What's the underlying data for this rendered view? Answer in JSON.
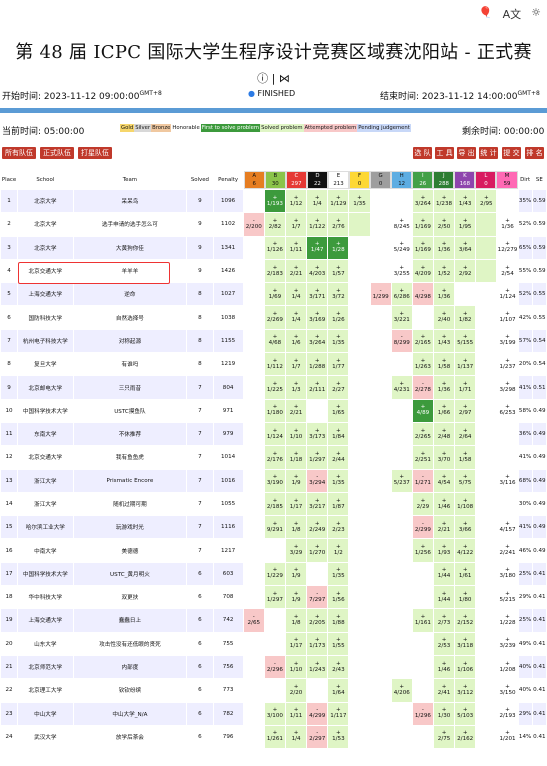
{
  "title": "第 48 届 ICPC 国际大学生程序设计竞赛区域赛沈阳站 - 正式赛",
  "top_icons": [
    "balloon-icon",
    "translate-icon",
    "settings-icon"
  ],
  "start_label": "开始时间: 2023-11-12 09:00:00",
  "start_tz": "GMT+8",
  "status": "FINISHED",
  "end_label": "结束时间: 2023-11-12 14:00:00",
  "end_tz": "GMT+8",
  "current_label": "当前时间: 05:00:00",
  "remaining_label": "剩余时间: 00:00:00",
  "legend": [
    "Gold",
    "Silver",
    "Bronze",
    "Honorable",
    "First to solve problem",
    "Solved problem",
    "Attempted problem",
    "Pending judgement"
  ],
  "buttons_left": [
    "所有队伍",
    "正式队伍",
    "打星队伍"
  ],
  "buttons_right": [
    "选 队",
    "工 具",
    "导 出",
    "统 计",
    "提 交",
    "排 名"
  ],
  "headers": {
    "place": "Place",
    "school": "School",
    "team": "Team",
    "solved": "Solved",
    "penalty": "Penalty",
    "dirt": "Dirt",
    "se": "SE"
  },
  "problems": [
    {
      "id": "A",
      "count": "6",
      "color": "#e67e22"
    },
    {
      "id": "B",
      "count": "30",
      "color": "#8bc34a"
    },
    {
      "id": "C",
      "count": "297",
      "color": "#e53935"
    },
    {
      "id": "D",
      "count": "22",
      "color": "#111111"
    },
    {
      "id": "E",
      "count": "213",
      "color": "#ffffff"
    },
    {
      "id": "F",
      "count": "0",
      "color": "#fdd835"
    },
    {
      "id": "G",
      "count": "0",
      "color": "#9e9e9e"
    },
    {
      "id": "H",
      "count": "12",
      "color": "#5dade2"
    },
    {
      "id": "I",
      "count": "26",
      "color": "#43a047"
    },
    {
      "id": "J",
      "count": "288",
      "color": "#2e7d32"
    },
    {
      "id": "K",
      "count": "168",
      "color": "#8e44ad"
    },
    {
      "id": "L",
      "count": "0",
      "color": "#d81b60"
    },
    {
      "id": "M",
      "count": "59",
      "color": "#ff69b4"
    }
  ],
  "rows": [
    {
      "place": "1",
      "school": "北京大学",
      "team": "呆呆鸟",
      "solved": "9",
      "penalty": "1096",
      "dirt": "35%",
      "se": "0.59",
      "cells": [
        "",
        "1/193",
        "1/12",
        "1/4",
        "1/129",
        "1/35",
        "",
        "",
        "3/264",
        "1/238",
        "1/43",
        "2/95",
        "",
        "4/135"
      ],
      "types": [
        "e",
        "f",
        "s",
        "s",
        "s",
        "s",
        "e",
        "e",
        "s",
        "s",
        "s",
        "s",
        "e",
        "s"
      ]
    },
    {
      "place": "2",
      "school": "北京大学",
      "team": "选手申请的选手怎么可",
      "solved": "9",
      "penalty": "1102",
      "dirt": "52%",
      "se": "0.59",
      "cells": [
        "2/200",
        "2/82",
        "1/7",
        "1/122",
        "2/76",
        "",
        "",
        "8/245",
        "1/169",
        "2/50",
        "1/95",
        "",
        "1/36"
      ],
      "types": [
        "a",
        "s",
        "s",
        "s",
        "s",
        "s",
        "e",
        "e",
        "s",
        "s",
        "s",
        "s",
        "e",
        "f"
      ]
    },
    {
      "place": "3",
      "school": "北京大学",
      "team": "大黄狗你佳",
      "solved": "9",
      "penalty": "1341",
      "dirt": "65%",
      "se": "0.59",
      "cells": [
        "",
        "1/126",
        "1/11",
        "1/47",
        "1/28",
        "",
        "",
        "5/249",
        "1/169",
        "1/36",
        "3/64",
        "",
        "12/279"
      ],
      "types": [
        "e",
        "s",
        "s",
        "f",
        "f",
        "e",
        "e",
        "e",
        "s",
        "s",
        "s",
        "s",
        "e",
        "s"
      ]
    },
    {
      "place": "4",
      "school": "北京交通大学",
      "team": "羊羊羊",
      "solved": "9",
      "penalty": "1426",
      "dirt": "55%",
      "se": "0.59",
      "cells": [
        "",
        "2/183",
        "2/21",
        "4/203",
        "1/57",
        "",
        "",
        "3/255",
        "4/209",
        "1/52",
        "2/92",
        "",
        "2/54"
      ],
      "types": [
        "e",
        "s",
        "s",
        "s",
        "s",
        "e",
        "e",
        "e",
        "s",
        "s",
        "s",
        "s",
        "e",
        "s"
      ]
    },
    {
      "place": "5",
      "school": "上海交通大学",
      "team": "逆命",
      "solved": "8",
      "penalty": "1027",
      "dirt": "52%",
      "se": "0.55",
      "cells": [
        "",
        "1/69",
        "1/4",
        "3/171",
        "3/72",
        "",
        "1/299",
        "6/286",
        "4/298",
        "1/36",
        "",
        "",
        "1/124"
      ],
      "types": [
        "e",
        "s",
        "s",
        "s",
        "s",
        "e",
        "a",
        "s",
        "a",
        "s",
        "e",
        "e",
        "e",
        "s"
      ]
    },
    {
      "place": "6",
      "school": "国防科技大学",
      "team": "自然选择号",
      "solved": "8",
      "penalty": "1038",
      "dirt": "42%",
      "se": "0.55",
      "cells": [
        "",
        "2/269",
        "1/4",
        "3/169",
        "1/26",
        "",
        "",
        "3/221",
        "",
        "2/40",
        "1/82",
        "",
        "1/107"
      ],
      "types": [
        "e",
        "s",
        "s",
        "s",
        "s",
        "e",
        "e",
        "s",
        "e",
        "s",
        "s",
        "e",
        "e",
        "s"
      ]
    },
    {
      "place": "7",
      "school": "杭州电子科技大学",
      "team": "对称起源",
      "solved": "8",
      "penalty": "1155",
      "dirt": "57%",
      "se": "0.54",
      "cells": [
        "",
        "4/68",
        "1/6",
        "3/264",
        "1/35",
        "",
        "",
        "8/299",
        "2/165",
        "1/43",
        "5/155",
        "",
        "3/199"
      ],
      "types": [
        "e",
        "s",
        "s",
        "s",
        "s",
        "e",
        "e",
        "a",
        "s",
        "s",
        "s",
        "e",
        "e",
        "s"
      ]
    },
    {
      "place": "8",
      "school": "复旦大学",
      "team": "有谁吗",
      "solved": "8",
      "penalty": "1219",
      "dirt": "20%",
      "se": "0.54",
      "cells": [
        "",
        "1/112",
        "1/7",
        "1/288",
        "1/77",
        "",
        "",
        "",
        "1/263",
        "1/58",
        "1/137",
        "",
        "1/237"
      ],
      "types": [
        "e",
        "s",
        "s",
        "s",
        "s",
        "e",
        "e",
        "e",
        "s",
        "s",
        "s",
        "e",
        "e",
        "s"
      ]
    },
    {
      "place": "9",
      "school": "北京邮电大学",
      "team": "三只雨昔",
      "solved": "7",
      "penalty": "804",
      "dirt": "41%",
      "se": "0.51",
      "cells": [
        "",
        "1/225",
        "1/3",
        "2/111",
        "2/27",
        "",
        "",
        "4/231",
        "2/278",
        "1/36",
        "1/71",
        "",
        "3/298"
      ],
      "types": [
        "e",
        "s",
        "s",
        "s",
        "s",
        "e",
        "e",
        "s",
        "a",
        "s",
        "s",
        "e",
        "e",
        "a"
      ]
    },
    {
      "place": "10",
      "school": "中国科学技术大学",
      "team": "USTC摸鱼队",
      "solved": "7",
      "penalty": "971",
      "dirt": "58%",
      "se": "0.49",
      "cells": [
        "",
        "1/180",
        "2/21",
        "",
        "1/65",
        "",
        "",
        "",
        "4/89",
        "1/66",
        "2/97",
        "",
        "6/253"
      ],
      "types": [
        "e",
        "s",
        "s",
        "e",
        "s",
        "e",
        "e",
        "e",
        "f",
        "s",
        "s",
        "e",
        "e",
        "s"
      ]
    },
    {
      "place": "11",
      "school": "东南大学",
      "team": "不休推荐",
      "solved": "7",
      "penalty": "979",
      "dirt": "36%",
      "se": "0.49",
      "cells": [
        "",
        "1/124",
        "1/10",
        "3/173",
        "1/84",
        "",
        "",
        "",
        "2/265",
        "2/48",
        "2/64",
        "",
        "",
        ""
      ],
      "types": [
        "e",
        "s",
        "s",
        "s",
        "s",
        "e",
        "e",
        "e",
        "s",
        "s",
        "s",
        "e",
        "e",
        "e"
      ]
    },
    {
      "place": "12",
      "school": "北京交通大学",
      "team": "我有鱼鱼虎",
      "solved": "7",
      "penalty": "1014",
      "dirt": "41%",
      "se": "0.49",
      "cells": [
        "",
        "2/176",
        "1/18",
        "1/297",
        "2/44",
        "",
        "",
        "",
        "2/251",
        "3/70",
        "1/58",
        "",
        "",
        ""
      ],
      "types": [
        "e",
        "s",
        "s",
        "s",
        "s",
        "e",
        "e",
        "e",
        "s",
        "s",
        "s",
        "e",
        "e",
        "e"
      ]
    },
    {
      "place": "13",
      "school": "浙江大学",
      "team": "Prismatic Encore",
      "solved": "7",
      "penalty": "1016",
      "dirt": "68%",
      "se": "0.49",
      "cells": [
        "",
        "3/190",
        "1/9",
        "3/294",
        "1/35",
        "",
        "",
        "5/237",
        "1/271",
        "4/54",
        "5/75",
        "",
        "3/116"
      ],
      "types": [
        "e",
        "s",
        "s",
        "a",
        "s",
        "e",
        "e",
        "s",
        "a",
        "s",
        "s",
        "e",
        "e",
        "s"
      ]
    },
    {
      "place": "14",
      "school": "浙江大学",
      "team": "随机过期可期",
      "solved": "7",
      "penalty": "1055",
      "dirt": "30%",
      "se": "0.49",
      "cells": [
        "",
        "2/185",
        "1/17",
        "3/217",
        "1/87",
        "",
        "",
        "",
        "2/29",
        "1/46",
        "1/108",
        "",
        "",
        ""
      ],
      "types": [
        "e",
        "s",
        "s",
        "s",
        "s",
        "e",
        "e",
        "e",
        "s",
        "s",
        "s",
        "e",
        "e",
        "e"
      ]
    },
    {
      "place": "15",
      "school": "哈尔滨工业大学",
      "team": "玩游戏时光",
      "solved": "7",
      "penalty": "1116",
      "dirt": "41%",
      "se": "0.49",
      "cells": [
        "",
        "9/291",
        "1/8",
        "2/249",
        "2/23",
        "",
        "",
        "",
        "2/299",
        "2/21",
        "3/66",
        "",
        "4/157"
      ],
      "types": [
        "e",
        "s",
        "s",
        "s",
        "s",
        "e",
        "e",
        "e",
        "a",
        "s",
        "s",
        "e",
        "e",
        "s"
      ]
    },
    {
      "place": "16",
      "school": "中南大学",
      "team": "美德德",
      "solved": "7",
      "penalty": "1217",
      "dirt": "46%",
      "se": "0.49",
      "cells": [
        "",
        "",
        "3/29",
        "1/270",
        "1/2",
        "",
        "",
        "",
        "1/256",
        "1/93",
        "4/122",
        "",
        "2/241"
      ],
      "types": [
        "e",
        "e",
        "s",
        "s",
        "s",
        "e",
        "e",
        "e",
        "s",
        "s",
        "s",
        "e",
        "e",
        "s"
      ]
    },
    {
      "place": "17",
      "school": "中国科学技术大学",
      "team": "USTC_黄月明火",
      "solved": "6",
      "penalty": "603",
      "dirt": "25%",
      "se": "0.41",
      "cells": [
        "",
        "1/229",
        "1/9",
        "",
        "1/35",
        "",
        "",
        "",
        "",
        "1/44",
        "1/61",
        "",
        "3/180"
      ],
      "types": [
        "e",
        "s",
        "s",
        "e",
        "s",
        "e",
        "e",
        "e",
        "e",
        "s",
        "s",
        "e",
        "e",
        "s"
      ]
    },
    {
      "place": "18",
      "school": "华中科技大学",
      "team": "双更扶",
      "solved": "6",
      "penalty": "708",
      "dirt": "29%",
      "se": "0.41",
      "cells": [
        "",
        "1/297",
        "1/9",
        "7/297",
        "1/56",
        "",
        "",
        "",
        "",
        "1/44",
        "1/80",
        "",
        "5/215"
      ],
      "types": [
        "e",
        "s",
        "s",
        "a",
        "s",
        "e",
        "e",
        "e",
        "e",
        "s",
        "s",
        "e",
        "e",
        "s"
      ]
    },
    {
      "place": "19",
      "school": "上海交通大学",
      "team": "蠢蠢日上",
      "solved": "6",
      "penalty": "742",
      "dirt": "25%",
      "se": "0.41",
      "cells": [
        "2/65",
        "",
        "1/8",
        "2/205",
        "1/88",
        "",
        "",
        "",
        "1/161",
        "2/73",
        "2/152",
        "",
        "1/228"
      ],
      "types": [
        "a",
        "e",
        "s",
        "s",
        "s",
        "e",
        "e",
        "e",
        "s",
        "s",
        "s",
        "e",
        "e",
        "s"
      ]
    },
    {
      "place": "20",
      "school": "山东大学",
      "team": "攻击性没有还低眼的贤死",
      "solved": "6",
      "penalty": "755",
      "dirt": "49%",
      "se": "0.41",
      "cells": [
        "",
        "",
        "1/17",
        "1/173",
        "1/55",
        "",
        "",
        "",
        "",
        "2/53",
        "3/118",
        "",
        "3/239"
      ],
      "types": [
        "e",
        "e",
        "s",
        "s",
        "s",
        "e",
        "e",
        "e",
        "e",
        "s",
        "s",
        "e",
        "e",
        "s"
      ]
    },
    {
      "place": "21",
      "school": "北京师范大学",
      "team": "内部度",
      "solved": "6",
      "penalty": "756",
      "dirt": "40%",
      "se": "0.41",
      "cells": [
        "",
        "2/296",
        "1/10",
        "1/243",
        "2/43",
        "",
        "",
        "",
        "",
        "1/46",
        "1/106",
        "",
        "1/208"
      ],
      "types": [
        "e",
        "a",
        "s",
        "s",
        "s",
        "e",
        "e",
        "e",
        "e",
        "s",
        "s",
        "e",
        "e",
        "s"
      ]
    },
    {
      "place": "22",
      "school": "北京理工大学",
      "team": "钦钦纷缤",
      "solved": "6",
      "penalty": "773",
      "dirt": "40%",
      "se": "0.41",
      "cells": [
        "",
        "",
        "2/20",
        "",
        "1/64",
        "",
        "",
        "4/206",
        "",
        "2/41",
        "3/112",
        "",
        "3/150"
      ],
      "types": [
        "e",
        "e",
        "s",
        "e",
        "s",
        "e",
        "e",
        "s",
        "e",
        "s",
        "s",
        "e",
        "e",
        "s"
      ]
    },
    {
      "place": "23",
      "school": "中山大学",
      "team": "中山大学_N/A",
      "solved": "6",
      "penalty": "782",
      "dirt": "29%",
      "se": "0.41",
      "cells": [
        "",
        "3/100",
        "1/11",
        "4/299",
        "1/117",
        "",
        "",
        "",
        "1/296",
        "1/30",
        "5/103",
        "",
        "2/193"
      ],
      "types": [
        "e",
        "s",
        "s",
        "a",
        "s",
        "e",
        "e",
        "e",
        "a",
        "s",
        "s",
        "e",
        "e",
        "s"
      ]
    },
    {
      "place": "24",
      "school": "武汉大学",
      "team": "放学后茶会",
      "solved": "6",
      "penalty": "796",
      "dirt": "14%",
      "se": "0.41",
      "cells": [
        "",
        "1/261",
        "1/4",
        "2/297",
        "1/53",
        "",
        "",
        "",
        "",
        "2/75",
        "2/162",
        "",
        "1/201"
      ],
      "types": [
        "e",
        "s",
        "s",
        "a",
        "s",
        "e",
        "e",
        "e",
        "e",
        "s",
        "s",
        "e",
        "e",
        "s"
      ]
    }
  ]
}
